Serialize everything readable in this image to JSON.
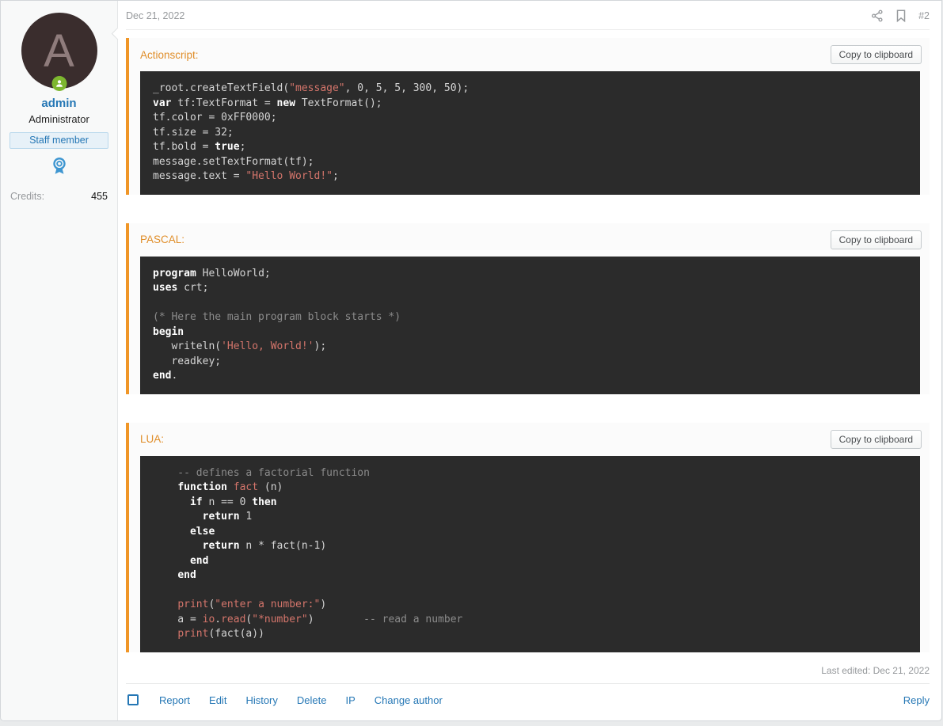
{
  "colors": {
    "accent-orange": "#f09627",
    "label-orange": "#e08e2a",
    "link-blue": "#2577b5",
    "code-bg": "#2b2b2b",
    "code-text": "#d5d5d5",
    "code-string": "#d4756b",
    "code-comment": "#8b8b8b",
    "online-green": "#7db72f"
  },
  "post": {
    "date": "Dec 21, 2022",
    "number": "#2",
    "last_edited": "Last edited: Dec 21, 2022"
  },
  "icons": {
    "share": "share-icon",
    "bookmark": "bookmark-icon",
    "online": "online-indicator-icon",
    "award": "award-icon"
  },
  "user": {
    "avatar_letter": "A",
    "username": "admin",
    "title": "Administrator",
    "banner": "Staff member",
    "credits_label": "Credits:",
    "credits_value": "455"
  },
  "code_blocks": [
    {
      "id": "actionscript",
      "language_label": "Actionscript:",
      "copy_label": "Copy to clipboard",
      "lines": [
        [
          [
            "",
            "_root.createTextField("
          ],
          [
            "s",
            "\"message\""
          ],
          [
            "",
            ", 0, 5, 5, 300, 50);"
          ]
        ],
        [
          [
            "k",
            "var"
          ],
          [
            "",
            " tf:TextFormat = "
          ],
          [
            "k",
            "new"
          ],
          [
            "",
            " TextFormat();"
          ]
        ],
        [
          [
            "",
            "tf.color = 0xFF0000;"
          ]
        ],
        [
          [
            "",
            "tf.size = 32;"
          ]
        ],
        [
          [
            "",
            "tf.bold = "
          ],
          [
            "k",
            "true"
          ],
          [
            "",
            ";"
          ]
        ],
        [
          [
            "",
            "message.setTextFormat(tf);"
          ]
        ],
        [
          [
            "",
            "message.text = "
          ],
          [
            "s",
            "\"Hello World!\""
          ],
          [
            "",
            ";"
          ]
        ]
      ]
    },
    {
      "id": "pascal",
      "language_label": "PASCAL:",
      "copy_label": "Copy to clipboard",
      "lines": [
        [
          [
            "k",
            "program"
          ],
          [
            "",
            " HelloWorld;"
          ]
        ],
        [
          [
            "k",
            "uses"
          ],
          [
            "",
            " crt;"
          ]
        ],
        [],
        [
          [
            "c",
            "(* Here the main program block starts *)"
          ]
        ],
        [
          [
            "k",
            "begin"
          ]
        ],
        [
          [
            "",
            "   writeln("
          ],
          [
            "s",
            "'Hello, World!'"
          ],
          [
            "",
            ");"
          ]
        ],
        [
          [
            "",
            "   readkey;"
          ]
        ],
        [
          [
            "k",
            "end"
          ],
          [
            "",
            "."
          ]
        ]
      ]
    },
    {
      "id": "lua",
      "language_label": "LUA:",
      "copy_label": "Copy to clipboard",
      "lines": [
        [
          [
            "c",
            "    -- defines a factorial function"
          ]
        ],
        [
          [
            "",
            "    "
          ],
          [
            "k",
            "function"
          ],
          [
            "",
            " "
          ],
          [
            "s",
            "fact"
          ],
          [
            "",
            " (n)"
          ]
        ],
        [
          [
            "",
            "      "
          ],
          [
            "k",
            "if"
          ],
          [
            "",
            " n == 0 "
          ],
          [
            "k",
            "then"
          ]
        ],
        [
          [
            "",
            "        "
          ],
          [
            "k",
            "return"
          ],
          [
            "",
            " 1"
          ]
        ],
        [
          [
            "",
            "      "
          ],
          [
            "k",
            "else"
          ]
        ],
        [
          [
            "",
            "        "
          ],
          [
            "k",
            "return"
          ],
          [
            "",
            " n * fact(n-1)"
          ]
        ],
        [
          [
            "",
            "      "
          ],
          [
            "k",
            "end"
          ]
        ],
        [
          [
            "",
            "    "
          ],
          [
            "k",
            "end"
          ]
        ],
        [],
        [
          [
            "",
            "    "
          ],
          [
            "s",
            "print"
          ],
          [
            "",
            "("
          ],
          [
            "s",
            "\"enter a number:\""
          ],
          [
            "",
            ")"
          ]
        ],
        [
          [
            "",
            "    a = "
          ],
          [
            "s",
            "io"
          ],
          [
            "",
            "."
          ],
          [
            "s",
            "read"
          ],
          [
            "",
            "("
          ],
          [
            "s",
            "\"*number\""
          ],
          [
            "",
            ")        "
          ],
          [
            "c",
            "-- read a number"
          ]
        ],
        [
          [
            "",
            "    "
          ],
          [
            "s",
            "print"
          ],
          [
            "",
            "(fact(a))"
          ]
        ]
      ]
    }
  ],
  "footer": {
    "checkbox_checked": false,
    "links": [
      "Report",
      "Edit",
      "History",
      "Delete",
      "IP",
      "Change author"
    ],
    "reply_label": "Reply"
  }
}
